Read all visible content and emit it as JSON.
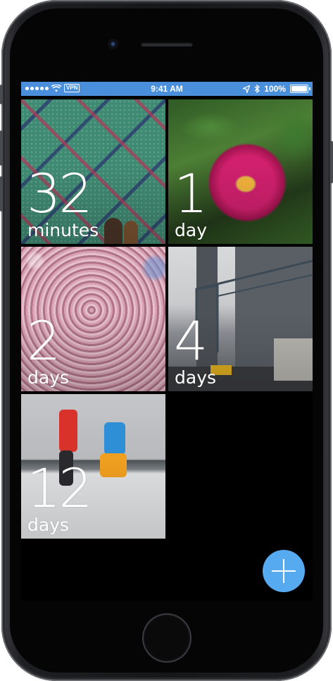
{
  "status_bar": {
    "time": "9:41 AM",
    "vpn": "VPN",
    "battery_text": "100%",
    "battery_level": 1.0,
    "icons": [
      "signal-dots-icon",
      "wifi-icon",
      "location-arrow-icon",
      "bluetooth-icon",
      "battery-icon"
    ]
  },
  "tiles": [
    {
      "number": "32",
      "unit": "minutes",
      "photo": "airport-carpet"
    },
    {
      "number": "1",
      "unit": "day",
      "photo": "pink-tulip"
    },
    {
      "number": "2",
      "unit": "days",
      "photo": "cherry-blossom-tree"
    },
    {
      "number": "4",
      "unit": "days",
      "photo": "williamsburg-bridge"
    },
    {
      "number": "12",
      "unit": "days",
      "photo": "snowshoe-jump"
    }
  ],
  "fab": {
    "icon": "plus-icon"
  },
  "colors": {
    "status_bar_bg": "#4a8fdc",
    "fab_bg": "#56aaf0",
    "screen_bg": "#000000"
  }
}
